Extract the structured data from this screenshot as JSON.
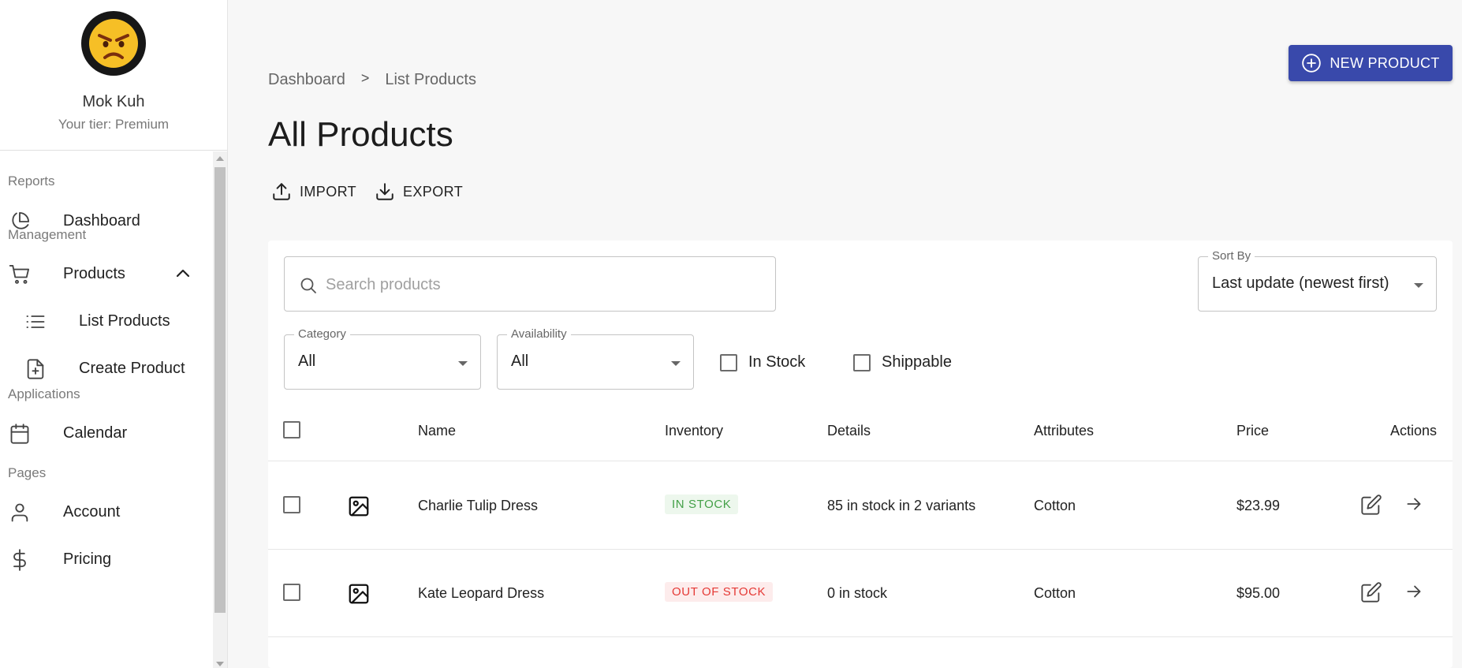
{
  "sidebar": {
    "profile": {
      "name": "Mok Kuh",
      "tier": "Your tier: Premium",
      "avatar_icon": "angry-face-emoji"
    },
    "sections": {
      "reports": "Reports",
      "management": "Management",
      "applications": "Applications",
      "pages": "Pages"
    },
    "items": {
      "dashboard": {
        "label": "Dashboard",
        "icon": "pie-chart-icon"
      },
      "products": {
        "label": "Products",
        "icon": "cart-icon",
        "expanded": true
      },
      "list_products": {
        "label": "List Products",
        "icon": "list-icon"
      },
      "create_product": {
        "label": "Create Product",
        "icon": "file-plus-icon"
      },
      "calendar": {
        "label": "Calendar",
        "icon": "calendar-icon"
      },
      "account": {
        "label": "Account",
        "icon": "user-icon"
      },
      "pricing": {
        "label": "Pricing",
        "icon": "dollar-icon"
      }
    }
  },
  "breadcrumb": {
    "root": "Dashboard",
    "separator": ">",
    "current": "List Products"
  },
  "page": {
    "title": "All Products",
    "new_button": "NEW PRODUCT",
    "import_label": "IMPORT",
    "export_label": "EXPORT"
  },
  "filters": {
    "search_placeholder": "Search products",
    "search_value": "",
    "sort": {
      "label": "Sort By",
      "value": "Last update (newest first)"
    },
    "category": {
      "label": "Category",
      "value": "All"
    },
    "availability": {
      "label": "Availability",
      "value": "All"
    },
    "in_stock_label": "In Stock",
    "shippable_label": "Shippable"
  },
  "table": {
    "columns": {
      "name": "Name",
      "inventory": "Inventory",
      "details": "Details",
      "attributes": "Attributes",
      "price": "Price",
      "actions": "Actions"
    },
    "rows": [
      {
        "name": "Charlie Tulip Dress",
        "inventory": "IN STOCK",
        "details": "85 in stock in 2 variants",
        "attributes": "Cotton",
        "price": "$23.99"
      },
      {
        "name": "Kate Leopard Dress",
        "inventory": "OUT OF STOCK",
        "details": "0 in stock",
        "attributes": "Cotton",
        "price": "$95.00"
      }
    ]
  },
  "colors": {
    "primary": "#3949ab",
    "in_stock_text": "#43a047",
    "in_stock_bg": "#edf7ed",
    "out_stock_text": "#e53935",
    "out_stock_bg": "#fdecec"
  }
}
